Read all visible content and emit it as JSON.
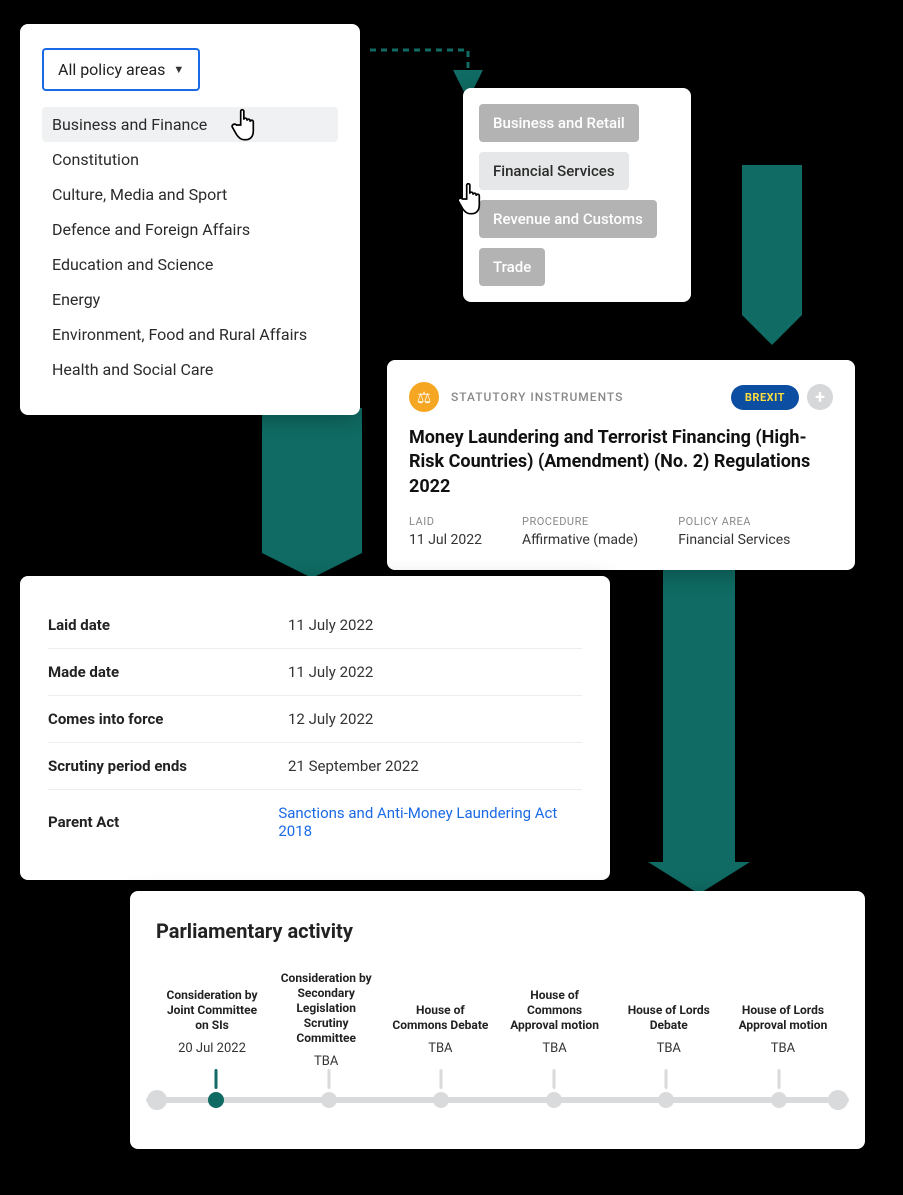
{
  "colors": {
    "teal": "#0f6b63",
    "blue": "#1b6ae5",
    "brexit_bg": "#0b4ea2",
    "brexit_text": "#fede3a",
    "scale": "#f5a623"
  },
  "dropdown": {
    "button_label": "All policy areas",
    "items": [
      "Business and Finance",
      "Constitution",
      "Culture, Media and Sport",
      "Defence and Foreign Affairs",
      "Education and Science",
      "Energy",
      "Environment, Food and Rural Affairs",
      "Health and Social Care"
    ],
    "hover_index": 0
  },
  "tags": {
    "items": [
      {
        "label": "Business and Retail",
        "active": false
      },
      {
        "label": "Financial Services",
        "active": true
      },
      {
        "label": "Revenue and Customs",
        "active": false
      },
      {
        "label": "Trade",
        "active": false
      }
    ]
  },
  "si": {
    "type_label": "STATUTORY INSTRUMENTS",
    "brexit_label": "BREXIT",
    "title": "Money Laundering and Terrorist Financing (High-Risk Countries) (Amendment) (No. 2) Regulations 2022",
    "meta": [
      {
        "label": "LAID",
        "value": "11 Jul 2022"
      },
      {
        "label": "PROCEDURE",
        "value": "Affirmative (made)"
      },
      {
        "label": "POLICY AREA",
        "value": "Financial Services"
      }
    ]
  },
  "dates": [
    {
      "label": "Laid date",
      "value": "11 July 2022",
      "link": false
    },
    {
      "label": "Made date",
      "value": "11 July 2022",
      "link": false
    },
    {
      "label": "Comes into force",
      "value": "12 July 2022",
      "link": false
    },
    {
      "label": "Scrutiny period ends",
      "value": "21 September 2022",
      "link": false
    },
    {
      "label": "Parent Act",
      "value": "Sanctions and Anti-Money Laundering Act 2018",
      "link": true
    }
  ],
  "activity": {
    "title": "Parliamentary activity",
    "stages": [
      {
        "label": "Consideration by Joint Committee on SIs",
        "date": "20 Jul 2022",
        "done": true
      },
      {
        "label": "Consideration by Secondary Legislation Scrutiny Committee",
        "date": "TBA",
        "done": false
      },
      {
        "label": "House of Commons Debate",
        "date": "TBA",
        "done": false
      },
      {
        "label": "House of Commons Approval motion",
        "date": "TBA",
        "done": false
      },
      {
        "label": "House of Lords Debate",
        "date": "TBA",
        "done": false
      },
      {
        "label": "House of Lords Approval motion",
        "date": "TBA",
        "done": false
      }
    ]
  }
}
